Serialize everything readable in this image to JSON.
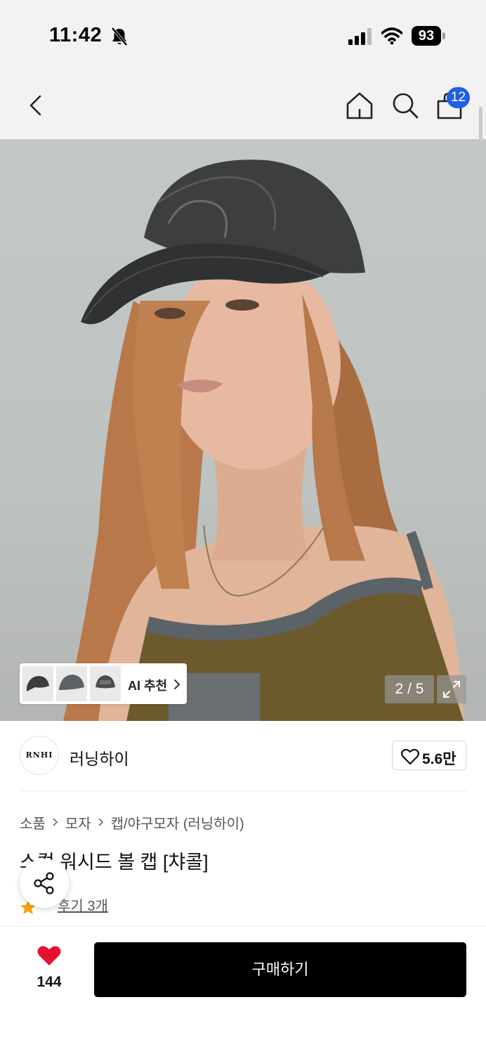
{
  "status_bar": {
    "time": "11:42",
    "battery": "93"
  },
  "nav": {
    "cart_count": "12"
  },
  "gallery": {
    "pager": "2 / 5",
    "ai_recommend_label": "AI 추천"
  },
  "brand": {
    "logo_text": "RNHI",
    "name": "러닝하이",
    "like_count": "5.6만"
  },
  "product": {
    "breadcrumb": [
      "소품",
      "모자",
      "캡/야구모자 (러닝하이)"
    ],
    "title": "스컬 워시드 볼 캡 [챠콜]",
    "review_label": "후기 3개"
  },
  "bottom_bar": {
    "wish_count": "144",
    "buy_label": "구매하기"
  },
  "colors": {
    "accent_blue": "#1e5fe6",
    "heart_red": "#e8112d",
    "star_orange": "#f5a312",
    "buy_black": "#000000"
  }
}
